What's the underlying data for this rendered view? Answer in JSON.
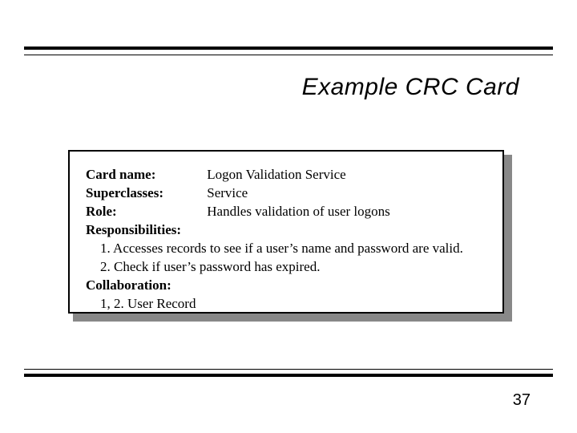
{
  "title": "Example CRC Card",
  "card": {
    "labels": {
      "name": "Card name",
      "superclasses": "Superclasses",
      "role": "Role",
      "responsibilities": "Responsibilities",
      "collaboration": "Collaboration"
    },
    "name_value": "Logon Validation Service",
    "superclasses_value": "Service",
    "role_value": "Handles validation of user logons",
    "responsibilities": [
      "1. Accesses records to see if a user’s name and password are valid.",
      "2. Check if user’s password has expired."
    ],
    "collaboration": [
      "1, 2. User Record"
    ]
  },
  "page_number": "37"
}
